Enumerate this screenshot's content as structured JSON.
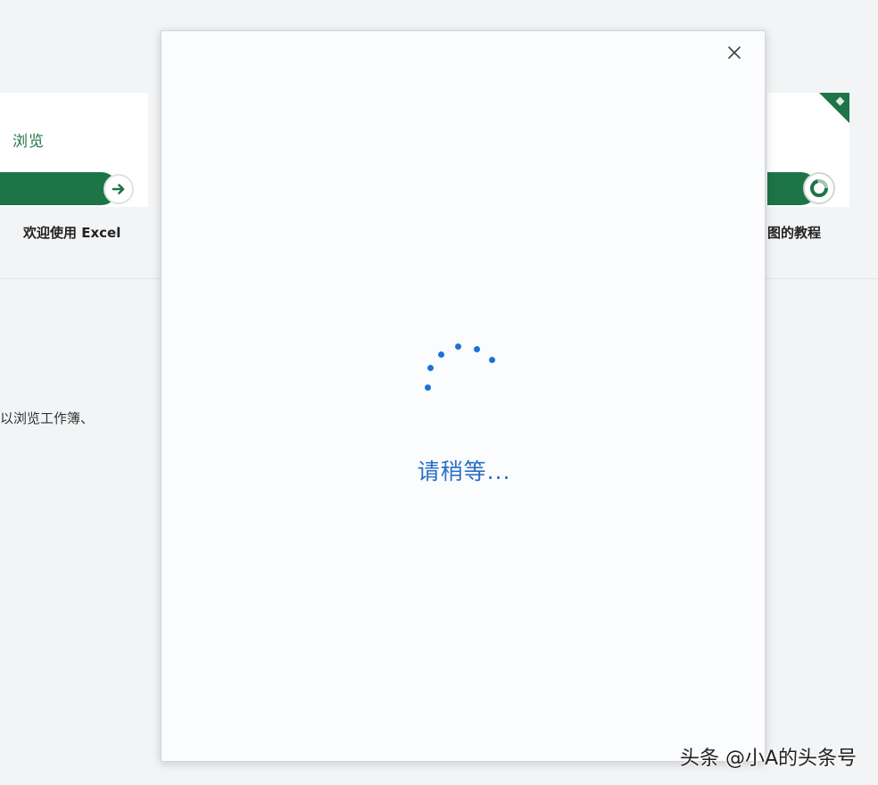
{
  "background": {
    "left_card": {
      "label": "浏览",
      "caption": "欢迎使用 Excel",
      "arrow_icon": "arrow-right-icon"
    },
    "right_card": {
      "caption": "图的教程",
      "icon": "ring-icon"
    },
    "side_text": "以浏览工作簿、"
  },
  "dialog": {
    "close_icon": "×",
    "loading_text": "请稍等...",
    "accent_color": "#1a73d9"
  },
  "watermark": "头条 @小A的头条号",
  "colors": {
    "excel_green": "#1d7446",
    "dialog_bg": "#fbfcfe",
    "loading_blue": "#2a6fc4"
  }
}
